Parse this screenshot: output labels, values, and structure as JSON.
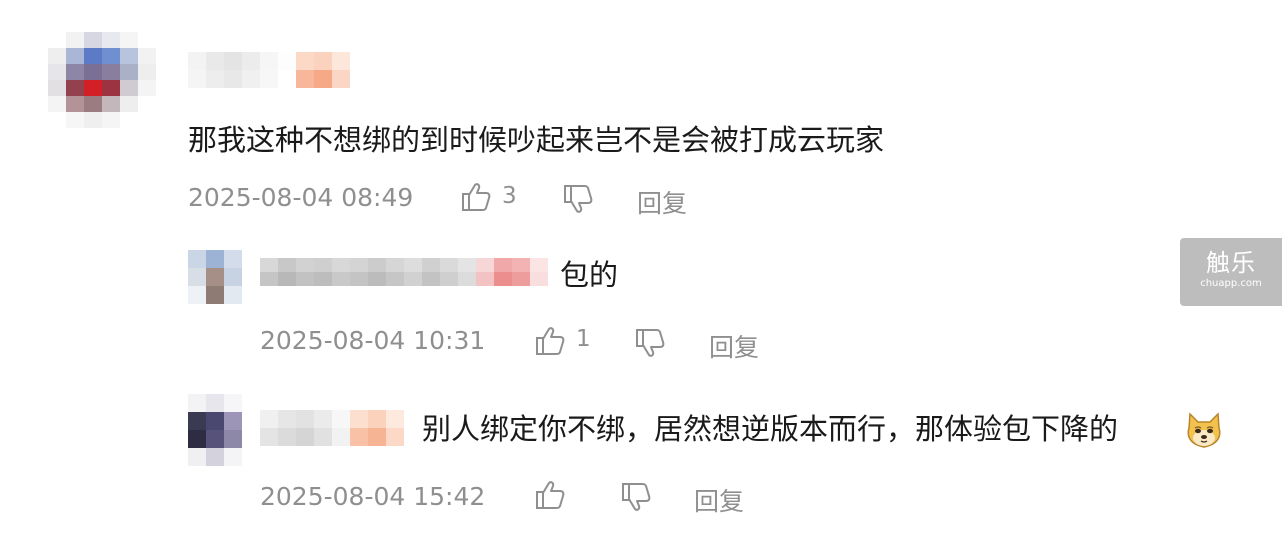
{
  "comments": [
    {
      "text": "那我这种不想绑的到时候吵起来岂不是会被打成云玩家",
      "timestamp": "2025-08-04 08:49",
      "likes": "3",
      "reply_label": "回复"
    }
  ],
  "replies": [
    {
      "text": "包的",
      "timestamp": "2025-08-04 10:31",
      "likes": "1",
      "reply_label": "回复"
    },
    {
      "text": "别人绑定你不绑，居然想逆版本而行，那体验包下降的",
      "emoji": "doge-emoji",
      "timestamp": "2025-08-04 15:42",
      "likes": "",
      "reply_label": "回复"
    }
  ],
  "watermark": {
    "logo": "触乐",
    "domain": "chuapp.com"
  },
  "colors": {
    "meta_gray": "#8f8f8f",
    "text_dark": "#1a1a1a",
    "watermark_bg": "#bdbdbd"
  }
}
